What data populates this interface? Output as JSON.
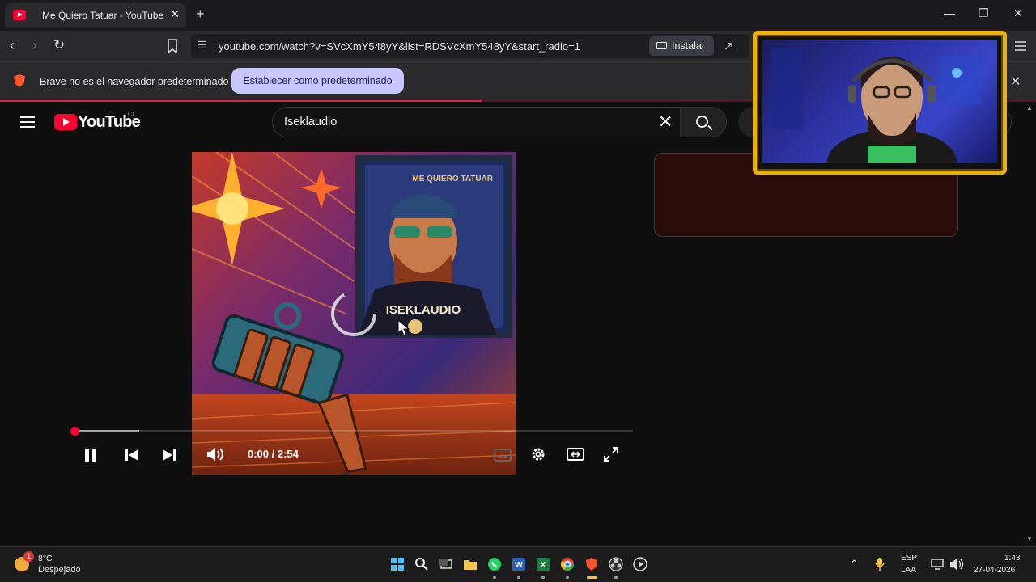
{
  "browser": {
    "tab_title": "Me Quiero Tatuar - YouTube",
    "tab_close": "✕",
    "new_tab": "+",
    "url": "youtube.com/watch?v=SVcXmY548yY&list=RDSVcXmY548yY&start_radio=1",
    "install_label": "Instalar",
    "window_controls": [
      "—",
      "❐",
      "✕"
    ]
  },
  "infobar": {
    "message": "Brave no es el navegador predeterminado",
    "set_default_label": "Establecer como predeterminado",
    "close": "✕"
  },
  "youtube": {
    "logo_text": "YouTube",
    "country": "CL",
    "search_query": "Iseklaudio",
    "clear_icon": "✕"
  },
  "video": {
    "artwork_title": "ME QUIERO TATUAR",
    "shirt_text": "ISEKLAUDIO",
    "progress_fraction": 0.0,
    "buffered_fraction": 0.116,
    "time_display": "0:00 / 2:54"
  },
  "taskbar": {
    "temperature": "8°C",
    "condition": "Despejado",
    "weather_badge": "1",
    "lang_line1": "ESP",
    "lang_line2": "LAA",
    "time": "1:43",
    "date": "27-04-2026"
  },
  "colors": {
    "yt_red": "#ff0033",
    "set_default_bg": "#c9c5ff",
    "cam_frame": "#e8b10b"
  }
}
